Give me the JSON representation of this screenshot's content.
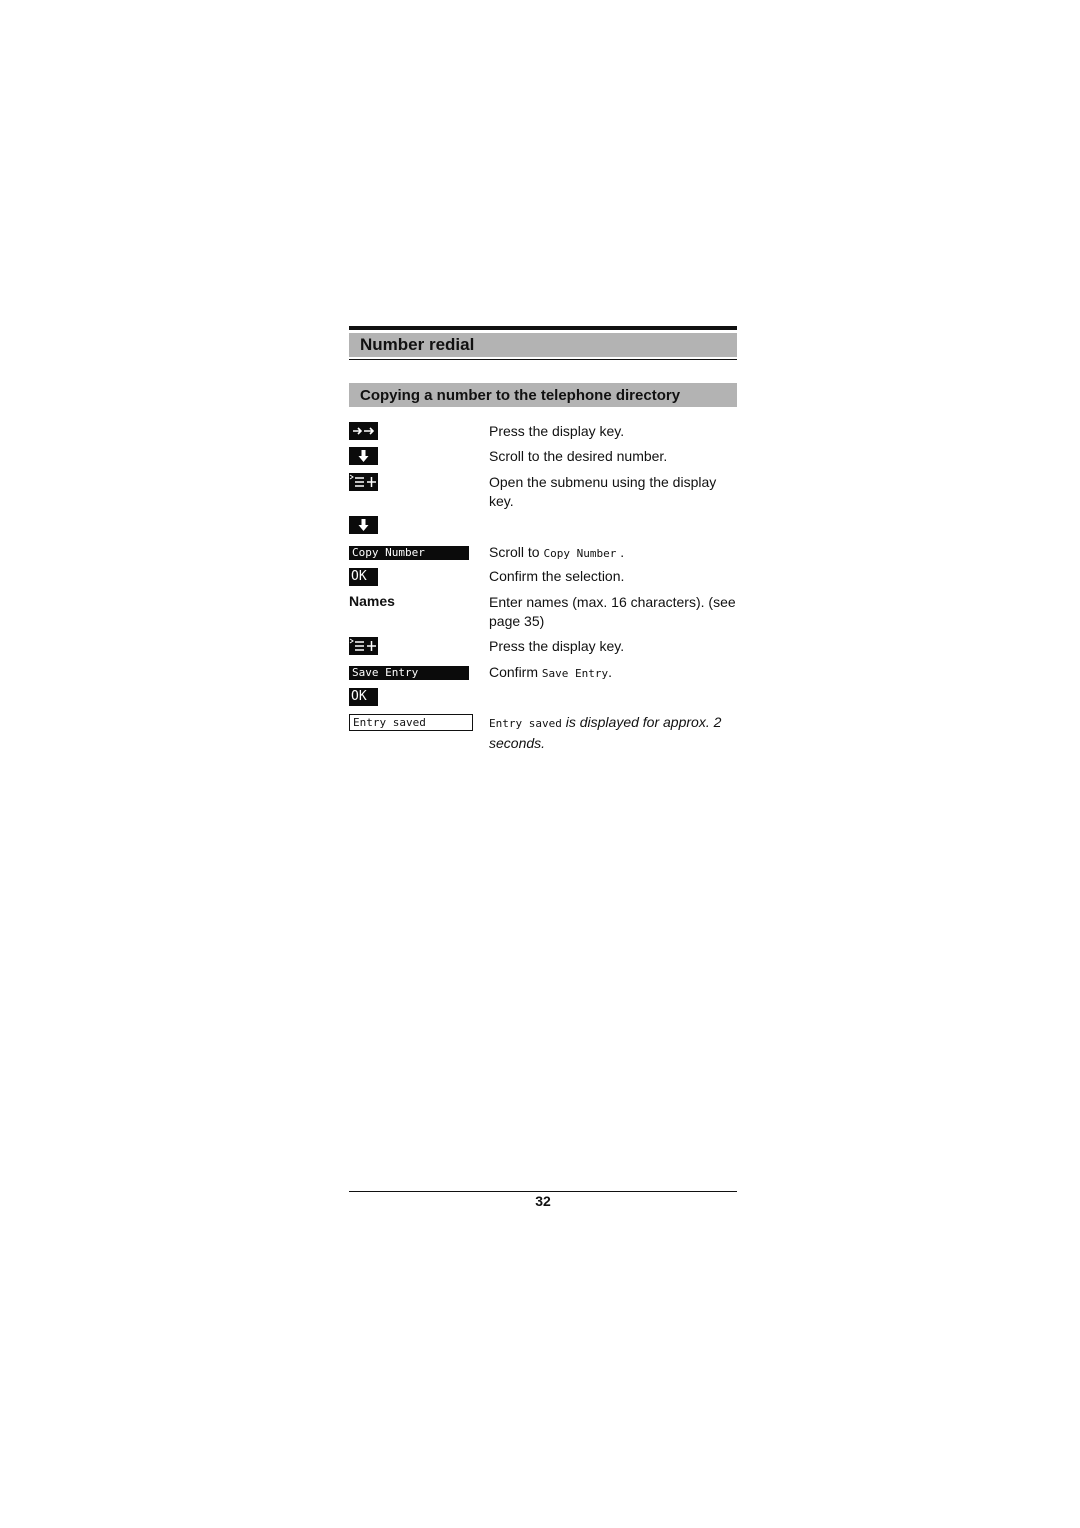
{
  "chapter": {
    "title": "Number redial"
  },
  "section": {
    "title": "Copying a number to the telephone directory"
  },
  "steps": [
    {
      "left_type": "icon",
      "icon": "arrow-right-double-icon",
      "text": "Press the display key."
    },
    {
      "left_type": "icon",
      "icon": "arrow-down-icon",
      "text": "Scroll to the desired number."
    },
    {
      "left_type": "icon",
      "icon": "submenu-icon",
      "text": "Open the submenu using the display key."
    },
    {
      "left_type": "icon",
      "icon": "arrow-down-icon",
      "text": ""
    },
    {
      "left_type": "lcd",
      "lcd": "Copy Number",
      "text_prefix": "Scroll to ",
      "text_mono": "Copy Number",
      "text_suffix": " ."
    },
    {
      "left_type": "lcd-ok",
      "lcd": "OK",
      "text": "Confirm the selection."
    },
    {
      "left_type": "label",
      "label": "Names",
      "text": "Enter names (max. 16 characters). (see page 35)"
    },
    {
      "left_type": "icon",
      "icon": "submenu-icon",
      "text": "Press the display key."
    },
    {
      "left_type": "lcd",
      "lcd": "Save Entry",
      "text_prefix": "Confirm ",
      "text_mono": "Save Entry",
      "text_suffix": "."
    },
    {
      "left_type": "lcd-ok",
      "lcd": "OK",
      "text": ""
    },
    {
      "left_type": "lcd-outline",
      "lcd": "Entry saved",
      "text_mono": "Entry saved",
      "text_italic": " is displayed for approx. 2 seconds."
    }
  ],
  "footer": {
    "page_number": "32"
  }
}
